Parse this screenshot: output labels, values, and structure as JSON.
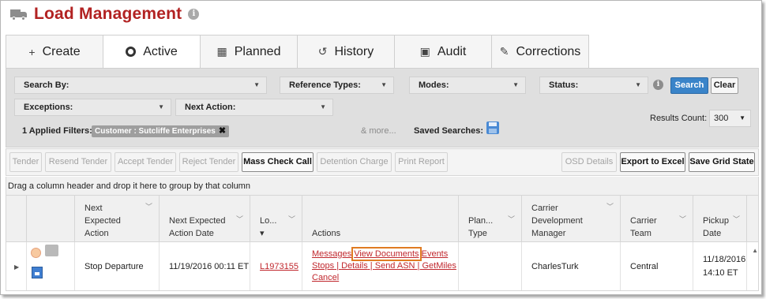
{
  "header": {
    "title": "Load Management",
    "info_glyph": "i"
  },
  "tabs": [
    {
      "label": "Create",
      "icon": "plus-icon"
    },
    {
      "label": "Active",
      "icon": "circle-icon"
    },
    {
      "label": "Planned",
      "icon": "calendar-icon"
    },
    {
      "label": "History",
      "icon": "history-icon"
    },
    {
      "label": "Audit",
      "icon": "clipboard-icon"
    },
    {
      "label": "Corrections",
      "icon": "pencil-icon"
    }
  ],
  "filters": {
    "search_by": "Search By:",
    "reference_types": "Reference Types:",
    "modes": "Modes:",
    "status": "Status:",
    "exceptions": "Exceptions:",
    "next_action": "Next Action:",
    "search_button": "Search",
    "clear_button": "Clear",
    "applied_label": "1 Applied Filters:",
    "applied_chip": "Customer : Sutcliffe Enterprises",
    "more_link": "& more...",
    "saved_searches": "Saved Searches:",
    "results_count_label": "Results Count:",
    "results_count_value": "300"
  },
  "toolbar": {
    "buttons": [
      {
        "label": "Tender",
        "enabled": false
      },
      {
        "label": "Resend Tender",
        "enabled": false
      },
      {
        "label": "Accept Tender",
        "enabled": false
      },
      {
        "label": "Reject Tender",
        "enabled": false
      },
      {
        "label": "Mass Check Call",
        "enabled": true
      },
      {
        "label": "Detention Charge",
        "enabled": false
      },
      {
        "label": "Print Report",
        "enabled": false
      },
      {
        "label": "OSD Details",
        "enabled": false
      },
      {
        "label": "Export to Excel",
        "enabled": true
      },
      {
        "label": "Save Grid State",
        "enabled": true
      }
    ]
  },
  "grid": {
    "group_hint": "Drag a column header and drop it here to group by that column",
    "headers": {
      "next_expected_action": [
        "Next",
        "Expected",
        "Action"
      ],
      "next_expected_action_date": [
        "Next Expected",
        "Action Date"
      ],
      "load": [
        "Lo...",
        "▾"
      ],
      "actions": "Actions",
      "plan_type": [
        "Plan...",
        "Type"
      ],
      "carrier_dev_manager": [
        "Carrier",
        "Development",
        "Manager"
      ],
      "carrier_team": [
        "Carrier",
        "Team"
      ],
      "pickup_date": [
        "Pickup",
        "Date"
      ]
    },
    "rows": [
      {
        "next_expected_action": "Stop Departure",
        "next_expected_action_date": "11/19/2016 00:11 ET",
        "load": "L1973155",
        "actions": {
          "messages": "Messages",
          "view_documents": "View Documents",
          "events": "Events",
          "stops": "Stops",
          "details": "Details",
          "send_asn": "Send ASN",
          "get_miles": "GetMiles",
          "cancel": "Cancel"
        },
        "plan_type": "",
        "carrier_dev_manager": "CharlesTurk",
        "carrier_team": "Central",
        "pickup_date_line1": "11/18/2016",
        "pickup_date_line2": "14:10 ET"
      }
    ]
  },
  "colors": {
    "title": "#b22222",
    "link": "#c0272d",
    "search_button": "#3a84c9",
    "highlight": "#e07b22"
  }
}
